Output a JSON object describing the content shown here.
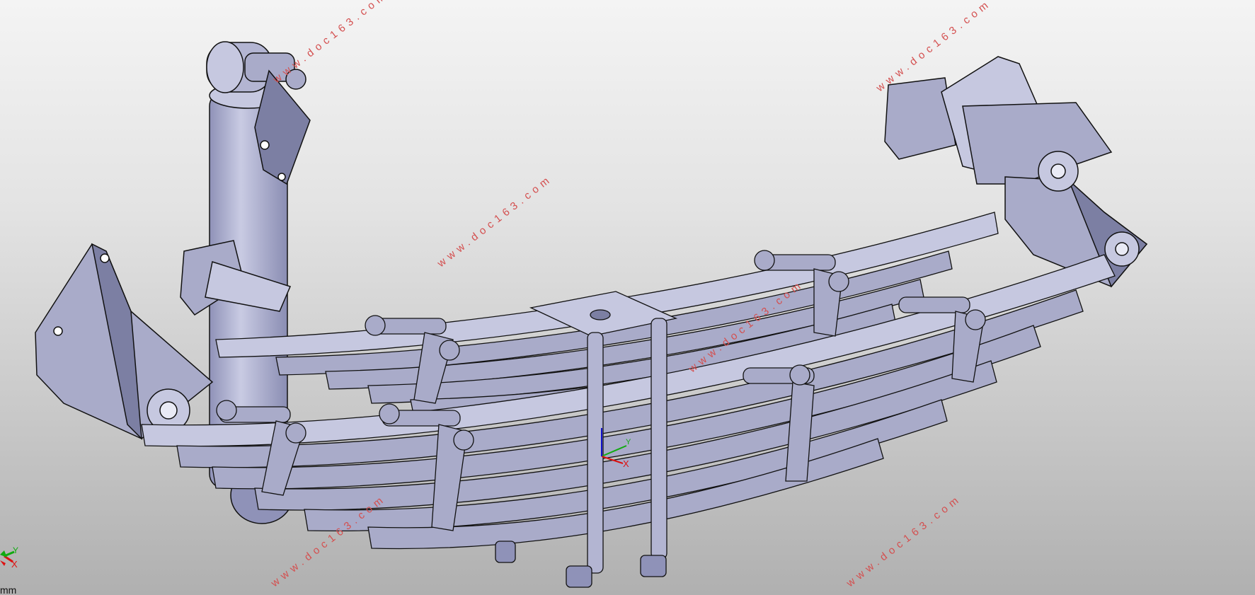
{
  "watermarks": [
    "www.doc163.com",
    "www.doc163.com",
    "www.doc163.com",
    "www.doc163.com",
    "www.doc163.com",
    "www.doc163.com"
  ],
  "compass": {
    "y_label": "Y",
    "x_label": "X"
  },
  "main_triad": {
    "y_label": "Y",
    "x_label": "X"
  },
  "status": {
    "units": "mm"
  },
  "colors": {
    "part_fill": "#a9abc9",
    "part_dark": "#7c7fa3",
    "part_light": "#c6c8e0",
    "edge": "#111111",
    "watermark": "#d45050",
    "axis_x": "#dd1111",
    "axis_y": "#11aa11",
    "axis_z": "#1111cc"
  }
}
